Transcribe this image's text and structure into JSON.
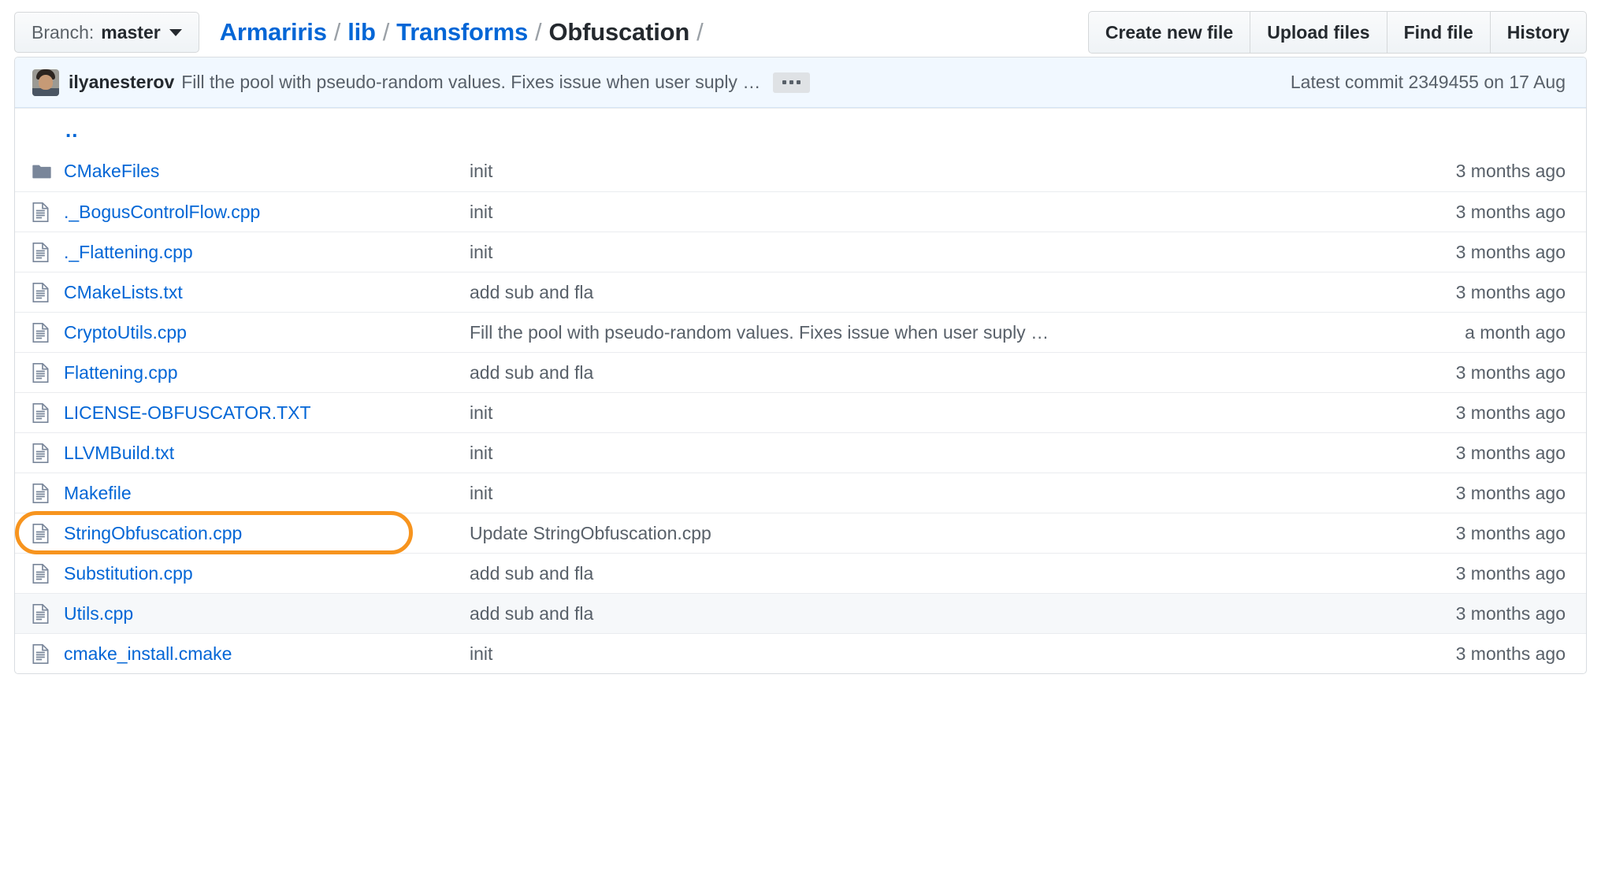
{
  "toolbar": {
    "branch_prefix": "Branch:",
    "branch_name": "master",
    "actions": [
      {
        "label": "Create new file",
        "name": "create-new-file-button"
      },
      {
        "label": "Upload files",
        "name": "upload-files-button"
      },
      {
        "label": "Find file",
        "name": "find-file-button"
      },
      {
        "label": "History",
        "name": "history-button"
      }
    ]
  },
  "breadcrumb": {
    "separator": "/",
    "parts": [
      {
        "label": "Armariris",
        "current": false
      },
      {
        "label": "lib",
        "current": false
      },
      {
        "label": "Transforms",
        "current": false
      },
      {
        "label": "Obfuscation",
        "current": true
      }
    ]
  },
  "commit_bar": {
    "author": "ilyanesterov",
    "message": "Fill the pool with pseudo-random values. Fixes issue when user suply …",
    "expand_label": "…",
    "latest_label": "Latest commit",
    "sha": "2349455",
    "on_label": "on",
    "date": "17 Aug"
  },
  "parent_dir": {
    "label": ".."
  },
  "files": [
    {
      "name": "CMakeFiles",
      "icon": "folder-icon",
      "type": "dir",
      "message": "init",
      "age": "3 months ago",
      "alt": false,
      "highlighted": false
    },
    {
      "name": "._BogusControlFlow.cpp",
      "icon": "file-icon",
      "type": "file",
      "message": "init",
      "age": "3 months ago",
      "alt": false,
      "highlighted": false
    },
    {
      "name": "._Flattening.cpp",
      "icon": "file-icon",
      "type": "file",
      "message": "init",
      "age": "3 months ago",
      "alt": false,
      "highlighted": false
    },
    {
      "name": "CMakeLists.txt",
      "icon": "file-icon",
      "type": "file",
      "message": "add sub and fla",
      "age": "3 months ago",
      "alt": false,
      "highlighted": false
    },
    {
      "name": "CryptoUtils.cpp",
      "icon": "file-icon",
      "type": "file",
      "message": "Fill the pool with pseudo-random values. Fixes issue when user suply …",
      "age": "a month ago",
      "alt": false,
      "highlighted": false
    },
    {
      "name": "Flattening.cpp",
      "icon": "file-icon",
      "type": "file",
      "message": "add sub and fla",
      "age": "3 months ago",
      "alt": false,
      "highlighted": false
    },
    {
      "name": "LICENSE-OBFUSCATOR.TXT",
      "icon": "file-icon",
      "type": "file",
      "message": "init",
      "age": "3 months ago",
      "alt": false,
      "highlighted": false
    },
    {
      "name": "LLVMBuild.txt",
      "icon": "file-icon",
      "type": "file",
      "message": "init",
      "age": "3 months ago",
      "alt": false,
      "highlighted": false
    },
    {
      "name": "Makefile",
      "icon": "file-icon",
      "type": "file",
      "message": "init",
      "age": "3 months ago",
      "alt": false,
      "highlighted": false
    },
    {
      "name": "StringObfuscation.cpp",
      "icon": "file-icon",
      "type": "file",
      "message": "Update StringObfuscation.cpp",
      "age": "3 months ago",
      "alt": false,
      "highlighted": true
    },
    {
      "name": "Substitution.cpp",
      "icon": "file-icon",
      "type": "file",
      "message": "add sub and fla",
      "age": "3 months ago",
      "alt": false,
      "highlighted": false
    },
    {
      "name": "Utils.cpp",
      "icon": "file-icon",
      "type": "file",
      "message": "add sub and fla",
      "age": "3 months ago",
      "alt": true,
      "highlighted": false
    },
    {
      "name": "cmake_install.cmake",
      "icon": "file-icon",
      "type": "file",
      "message": "init",
      "age": "3 months ago",
      "alt": false,
      "highlighted": false
    }
  ],
  "colors": {
    "link": "#0366d6",
    "muted": "#586069",
    "commit_bar_bg": "#f1f8ff",
    "row_alt_bg": "#f6f8fa",
    "annotation": "#f7941e"
  }
}
